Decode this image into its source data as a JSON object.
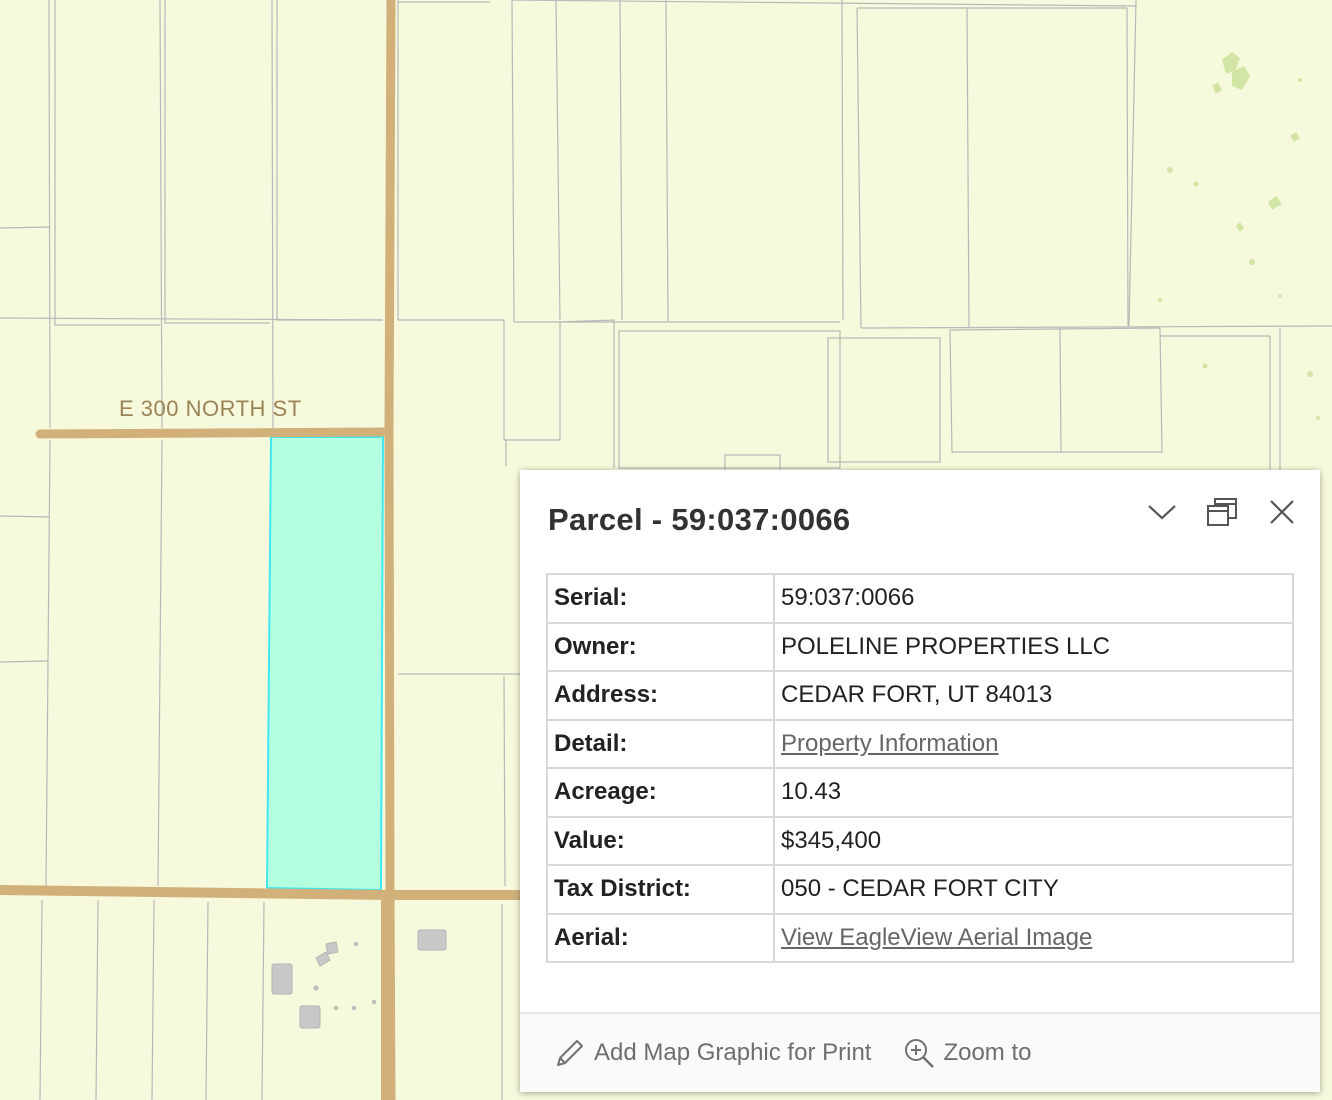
{
  "map": {
    "street_label": "E 300 NORTH ST",
    "colors": {
      "background": "#f7f9dc",
      "parcel_line": "#b8b8b8",
      "road": "#d2b07a",
      "selected_fill": "#b5ffe1",
      "selected_outline": "#3fe8f0",
      "building": "#c8c8c8",
      "vegetation": "#cfe3a0"
    }
  },
  "popup": {
    "title": "Parcel - 59:037:0066",
    "tools": {
      "collapse_icon": "chevron-down-icon",
      "dock_icon": "dock-icon",
      "close_icon": "close-icon"
    },
    "rows": [
      {
        "key": "Serial:",
        "value": "59:037:0066"
      },
      {
        "key": "Owner:",
        "value": "POLELINE PROPERTIES LLC"
      },
      {
        "key": "Address:",
        "value": "CEDAR FORT, UT 84013"
      },
      {
        "key": "Detail:",
        "value": "Property Information"
      },
      {
        "key": "Acreage:",
        "value": "10.43"
      },
      {
        "key": "Value:",
        "value": "$345,400"
      },
      {
        "key": "Tax District:",
        "value": "050 - CEDAR FORT CITY"
      },
      {
        "key": "Aerial:",
        "value": "View EagleView Aerial Image"
      }
    ],
    "footer": {
      "add_graphic": "Add Map Graphic for Print",
      "zoom_to": "Zoom to"
    }
  }
}
